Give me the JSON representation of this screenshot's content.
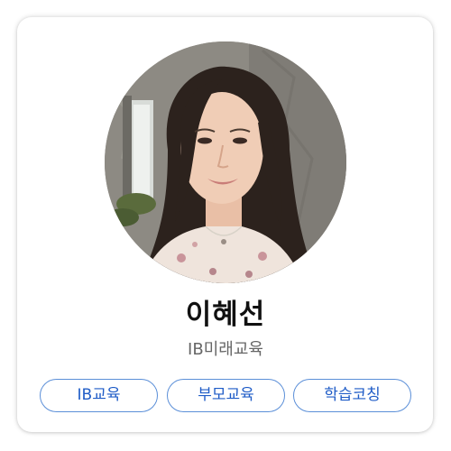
{
  "profile": {
    "name": "이혜선",
    "organization": "IB미래교육",
    "photo": "profile-photo"
  },
  "tags": [
    {
      "label": "IB교육"
    },
    {
      "label": "부모교육"
    },
    {
      "label": "학습코칭"
    }
  ],
  "colors": {
    "tag_border": "#5b8fd8",
    "tag_text": "#1f5cc7",
    "name_text": "#111111",
    "org_text": "#666666"
  }
}
